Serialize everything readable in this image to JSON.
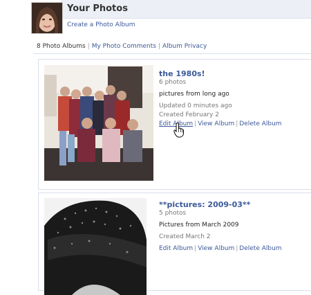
{
  "header": {
    "title": "Your Photos",
    "create_link": "Create a Photo Album"
  },
  "subnav": {
    "albums_count": "8 Photo Albums",
    "sep": "|",
    "comments_link": "My Photo Comments",
    "privacy_link": "Album Privacy"
  },
  "albums": [
    {
      "title": "the 1980s!",
      "count": "6 photos",
      "description": "pictures from long ago",
      "updated": "Updated 0 minutes ago",
      "created": "Created February 2",
      "edit": "Edit Album",
      "view": "View Album",
      "delete": "Delete Album"
    },
    {
      "title": "**pictures: 2009-03**",
      "count": "5 photos",
      "description": "Pictures from March 2009",
      "created": "Created March 2",
      "edit": "Edit Album",
      "view": "View Album",
      "delete": "Delete Album"
    }
  ],
  "colors": {
    "link": "#3b5998",
    "header_band": "#eceff5",
    "border": "#d8dfea"
  },
  "icons": {
    "cursor": "hand-pointer-icon"
  }
}
